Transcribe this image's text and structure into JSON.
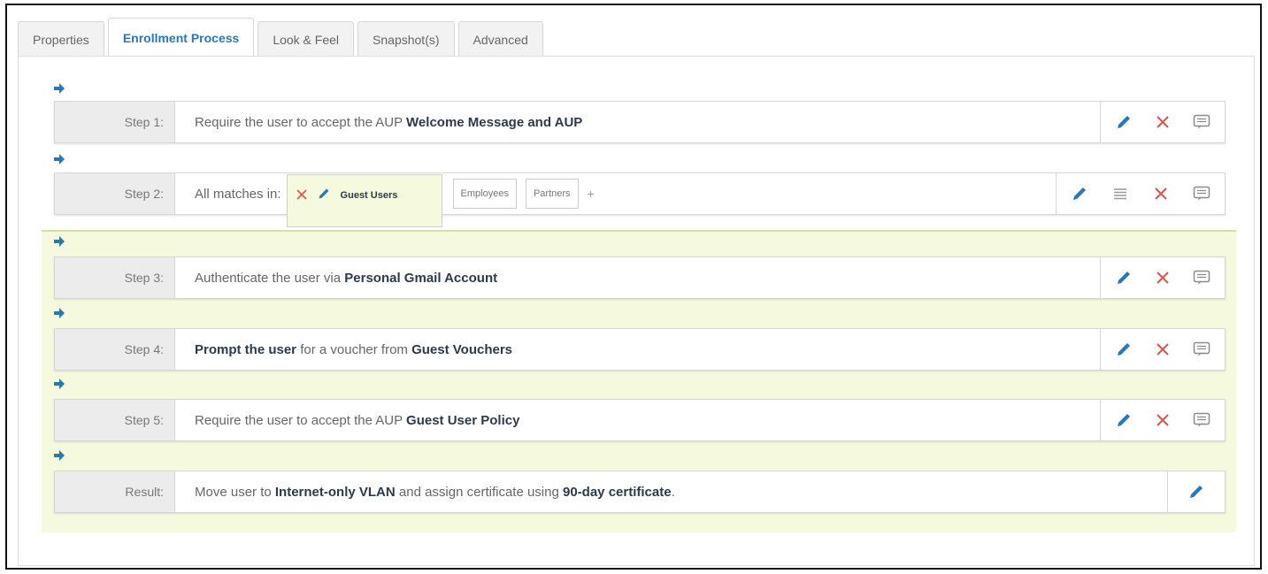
{
  "tabs": [
    {
      "label": "Properties",
      "active": false
    },
    {
      "label": "Enrollment Process",
      "active": true
    },
    {
      "label": "Look & Feel",
      "active": false
    },
    {
      "label": "Snapshot(s)",
      "active": false
    },
    {
      "label": "Advanced",
      "active": false
    }
  ],
  "steps": {
    "s1": {
      "label": "Step 1:",
      "prefix": "Require the user to accept the AUP ",
      "bold": "Welcome Message and AUP"
    },
    "s2": {
      "label": "Step 2:",
      "prefix": "All matches in:",
      "tag_selected": "Guest Users",
      "tags": [
        "Employees",
        "Partners"
      ],
      "add": "+"
    },
    "s3": {
      "label": "Step 3:",
      "prefix": "Authenticate the user via ",
      "bold": "Personal Gmail Account"
    },
    "s4": {
      "label": "Step 4:",
      "bold1": "Prompt the user",
      "mid": " for a voucher from ",
      "bold2": "Guest Vouchers"
    },
    "s5": {
      "label": "Step 5:",
      "prefix": "Require the user to accept the AUP ",
      "bold": "Guest User Policy"
    },
    "result": {
      "label": "Result:",
      "p1": "Move user to ",
      "b1": "Internet-only VLAN",
      "p2": " and assign certificate using ",
      "b2": "90-day certificate",
      "p3": "."
    }
  },
  "colors": {
    "accent": "#2a77b6",
    "delete": "#d9534f",
    "green_zone": "#f5fadf"
  },
  "icons": {
    "edit": "pencil-icon",
    "delete": "close-icon",
    "comment": "comment-icon",
    "reorder": "list-icon",
    "insert": "arrow-right-icon"
  }
}
